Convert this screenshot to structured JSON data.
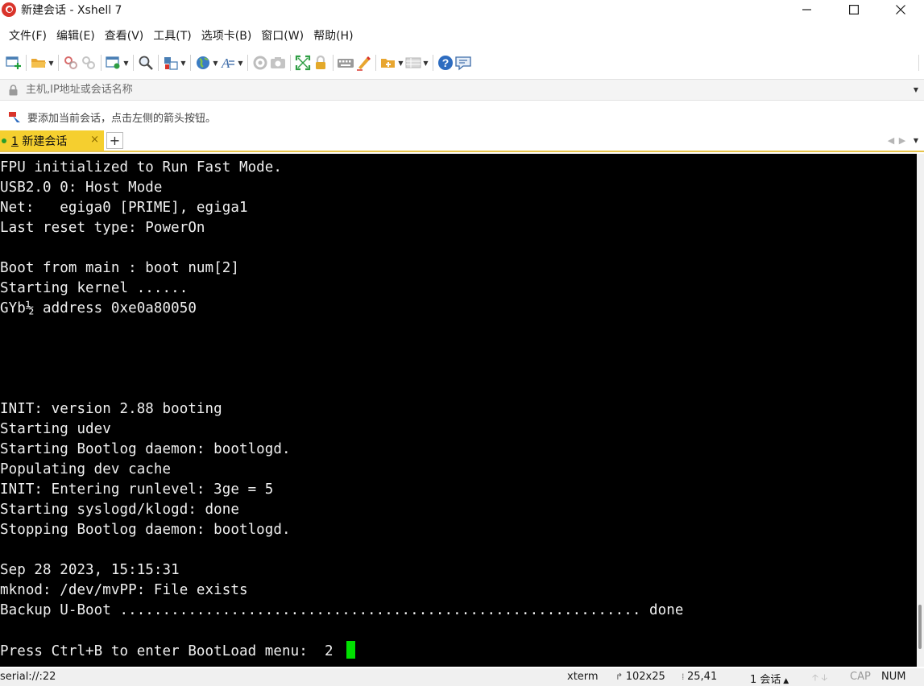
{
  "window": {
    "title": "新建会话 - Xshell 7",
    "minimize_icon": "minimize-icon",
    "maximize_icon": "maximize-icon",
    "close_icon": "close-icon"
  },
  "menu": {
    "items": [
      "文件(F)",
      "编辑(E)",
      "查看(V)",
      "工具(T)",
      "选项卡(B)",
      "窗口(W)",
      "帮助(H)"
    ]
  },
  "toolbar": {
    "icons": [
      "new-session-icon",
      "open-folder-icon",
      "connect-icon",
      "disconnect-icon",
      "session-properties-icon",
      "find-icon",
      "transfer-icon",
      "globe-icon",
      "font-icon",
      "xftp-icon",
      "screenshot-icon",
      "fullscreen-icon",
      "lock-icon",
      "keyboard-icon",
      "highlight-icon",
      "compose-icon",
      "layout-icon",
      "help-icon",
      "chat-icon"
    ]
  },
  "address": {
    "placeholder": "主机,IP地址或会话名称"
  },
  "hint": {
    "text": "要添加当前会话，点击左侧的箭头按钮。"
  },
  "tabs": {
    "active_number": "1",
    "active_label": " 新建会话",
    "close_glyph": "×",
    "add_glyph": "+"
  },
  "terminal": {
    "lines": [
      "FPU initialized to Run Fast Mode.",
      "USB2.0 0: Host Mode",
      "Net:   egiga0 [PRIME], egiga1",
      "Last reset type: PowerOn",
      "",
      "Boot from main : boot num[2]",
      "Starting kernel ......",
      "GYb½ address 0xe0a80050",
      "",
      "",
      "",
      "",
      "INIT: version 2.88 booting",
      "Starting udev",
      "Starting Bootlog daemon: bootlogd.",
      "Populating dev cache",
      "INIT: Entering runlevel: 3ge = 5",
      "Starting syslogd/klogd: done",
      "Stopping Bootlog daemon: bootlogd.",
      "",
      "Sep 28 2023, 15:15:31",
      "mknod: /dev/mvPP: File exists",
      "Backup U-Boot ............................................................. done",
      "",
      "Press Ctrl+B to enter BootLoad menu:  2 "
    ],
    "cursor_color": "#00e000"
  },
  "status": {
    "connection": "serial://:22",
    "term_type": "xterm",
    "size": "102x25",
    "position": "25,41",
    "sessions": "1 会话",
    "cap": "CAP",
    "num": "NUM"
  },
  "colors": {
    "tab_active": "#f5cf2f",
    "terminal_bg": "#000000",
    "terminal_fg": "#f0f0f0"
  }
}
